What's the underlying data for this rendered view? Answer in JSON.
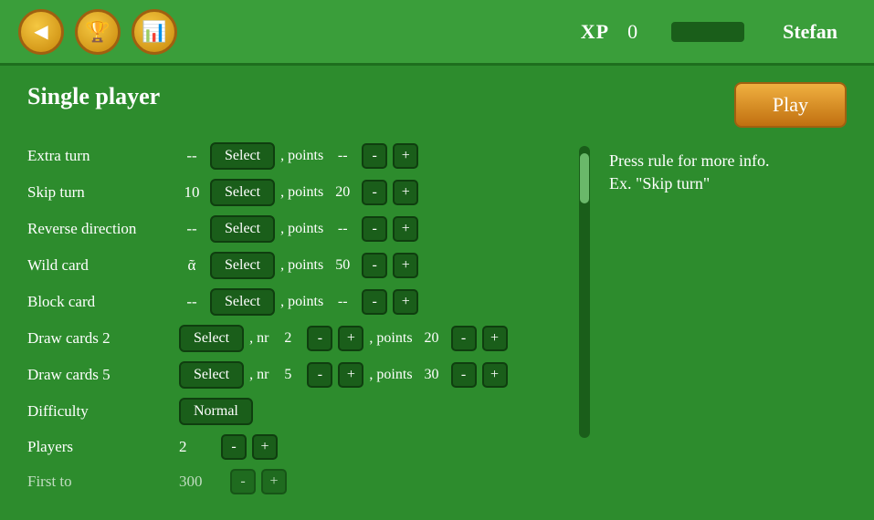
{
  "header": {
    "xp_label": "XP",
    "xp_value": "0",
    "user_name": "Stefan",
    "back_icon": "◀",
    "trophy_icon": "🏆",
    "chart_icon": "📊"
  },
  "panel": {
    "title": "Single player",
    "play_label": "Play"
  },
  "rules": [
    {
      "label": "Extra turn",
      "value": "--",
      "select_label": "Select",
      "points_label": ", points",
      "points_value": "--",
      "has_stepper": true
    },
    {
      "label": "Skip turn",
      "value": "10",
      "select_label": "Select",
      "points_label": ", points",
      "points_value": "20",
      "has_stepper": true
    },
    {
      "label": "Reverse direction",
      "value": "--",
      "select_label": "Select",
      "points_label": ", points",
      "points_value": "--",
      "has_stepper": true
    },
    {
      "label": "Wild card",
      "value": "ᾶ",
      "select_label": "Select",
      "points_label": ", points",
      "points_value": "50",
      "has_stepper": true
    },
    {
      "label": "Block card",
      "value": "--",
      "select_label": "Select",
      "points_label": ", points",
      "points_value": "--",
      "has_stepper": true
    },
    {
      "label": "Draw cards 2",
      "value": "",
      "select_label": "Select",
      "nr_label": ", nr",
      "nr_value": "2",
      "points_label": ", points",
      "points_value": "20",
      "has_nr": true,
      "has_stepper": true
    },
    {
      "label": "Draw cards 5",
      "value": "",
      "select_label": "Select",
      "nr_label": ", nr",
      "nr_value": "5",
      "points_label": ", points",
      "points_value": "30",
      "has_nr": true,
      "has_stepper": true
    }
  ],
  "difficulty": {
    "label": "Difficulty",
    "value": "Normal"
  },
  "players": {
    "label": "Players",
    "value": "2"
  },
  "first_to": {
    "label": "First to",
    "value": "300"
  },
  "info_panel": {
    "line1": "Press rule for more info.",
    "line2": "Ex. \"Skip turn\""
  }
}
